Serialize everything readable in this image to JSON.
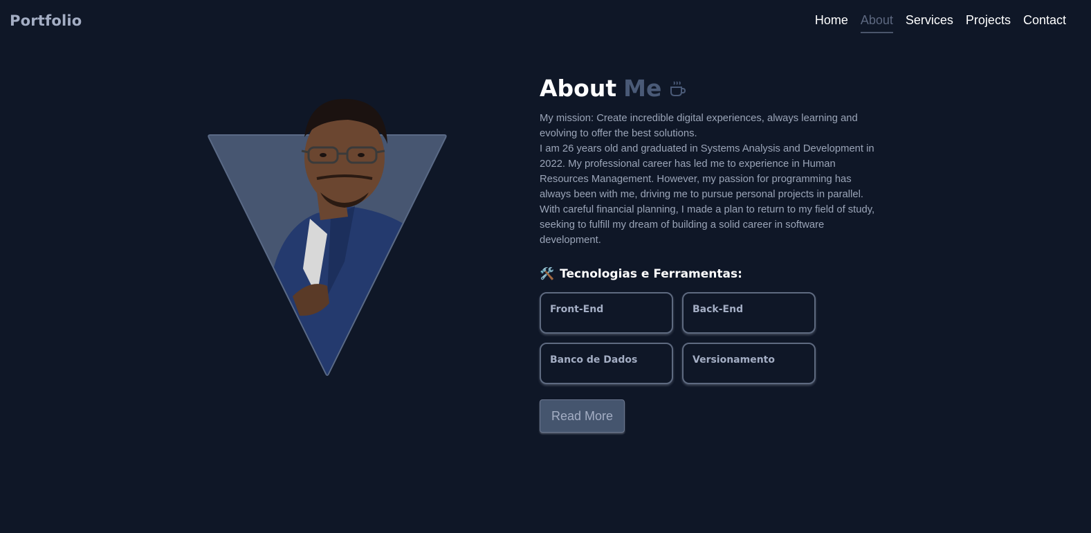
{
  "brand": "Portfolio",
  "nav": {
    "items": [
      {
        "label": "Home",
        "active": false
      },
      {
        "label": "About",
        "active": true
      },
      {
        "label": "Services",
        "active": false
      },
      {
        "label": "Projects",
        "active": false
      },
      {
        "label": "Contact",
        "active": false
      }
    ]
  },
  "portrait": {
    "icon": "profile-photo"
  },
  "about": {
    "title": "About",
    "title_accent": "Me",
    "title_icon": "coffee-cup-icon",
    "bio": [
      "My mission: Create incredible digital experiences, always learning and evolving to offer the best solutions.",
      "I am 26 years old and graduated in Systems Analysis and Development in 2022. My professional career has led me to experience in Human Resources Management. However, my passion for programming has always been with me, driving me to pursue personal projects in parallel. With careful financial planning, I made a plan to return to my field of study, seeking to fulfill my dream of building a solid career in software development."
    ],
    "tools_emoji": "🛠️",
    "tools_title": "Tecnologias e Ferramentas:",
    "tools": [
      "Front-End",
      "Back-End",
      "Banco de Dados",
      "Versionamento"
    ],
    "read_more": "Read More"
  },
  "colors": {
    "background": "#0f1727",
    "accent": "#4a5a77",
    "muted_text": "#9ba5b8",
    "triangle": "#475671"
  }
}
